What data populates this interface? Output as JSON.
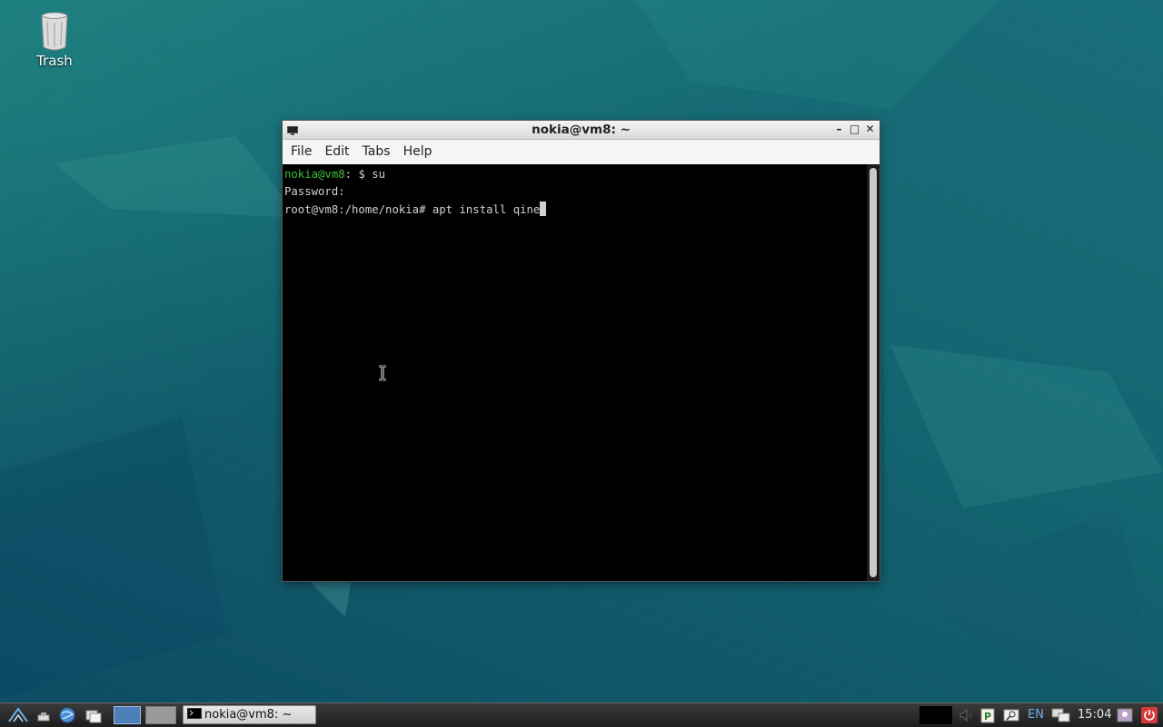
{
  "desktop": {
    "trash_label": "Trash"
  },
  "window": {
    "title": "nokia@vm8: ~",
    "controls": [
      "minimize",
      "maximize",
      "close"
    ],
    "menu": [
      "File",
      "Edit",
      "Tabs",
      "Help"
    ]
  },
  "terminal": {
    "line1_user": "nokia@vm8",
    "line1_rest": ": $ su",
    "line2": "Password:",
    "line3": "root@vm8:/home/nokia# apt install qine"
  },
  "taskbar": {
    "task_label": "nokia@vm8: ~",
    "lang": "EN",
    "clock": "15:04"
  },
  "colors": {
    "prompt_user": "#3fbf3f",
    "terminal_bg": "#000000",
    "terminal_fg": "#d0d0d0"
  }
}
